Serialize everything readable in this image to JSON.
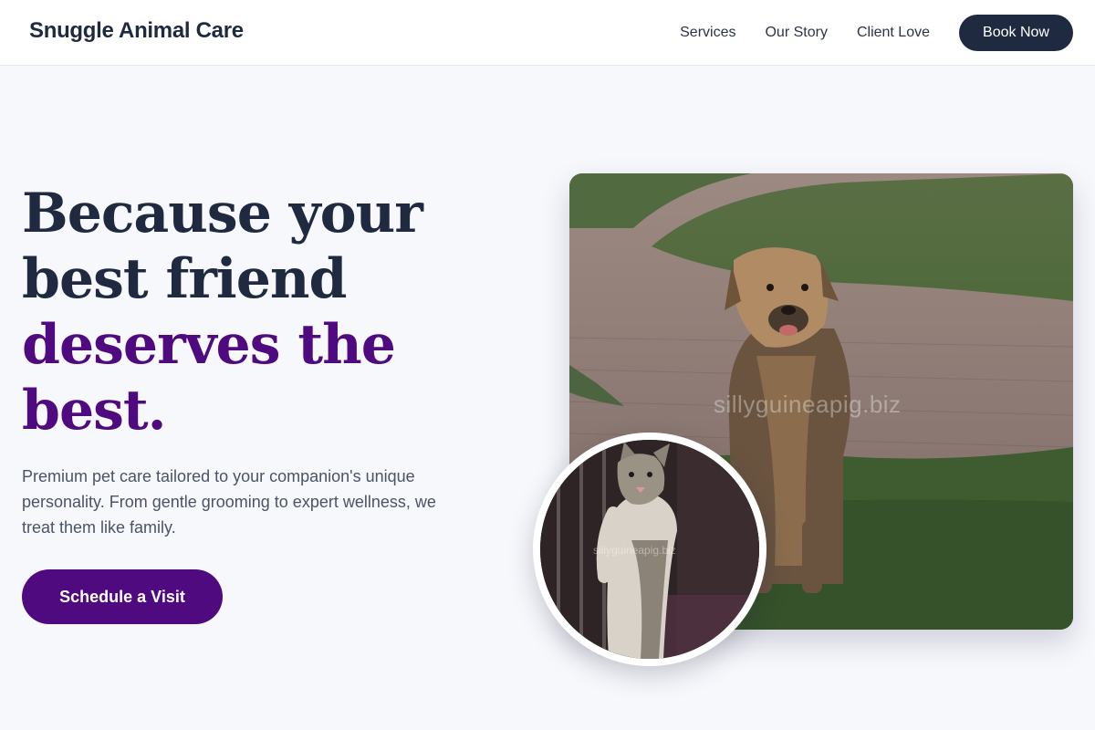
{
  "header": {
    "brand": "Snuggle Animal Care",
    "nav": [
      "Services",
      "Our Story",
      "Client Love"
    ],
    "cta_label": "Book Now"
  },
  "hero": {
    "headline_lines": [
      "Because your",
      "best friend",
      "deserves the",
      "best."
    ],
    "subtext": "Premium pet care tailored to your companion's unique personality. From gentle grooming to expert wellness, we treat them like family.",
    "cta_label": "Schedule a Visit"
  },
  "images": {
    "main_watermark": "sillyguineapig.biz",
    "inset_watermark": "sillyguineapig.biz"
  },
  "colors": {
    "primary_dark": "#1f2a40",
    "accent_purple": "#4f0a7f",
    "background": "#f7f8fc"
  }
}
